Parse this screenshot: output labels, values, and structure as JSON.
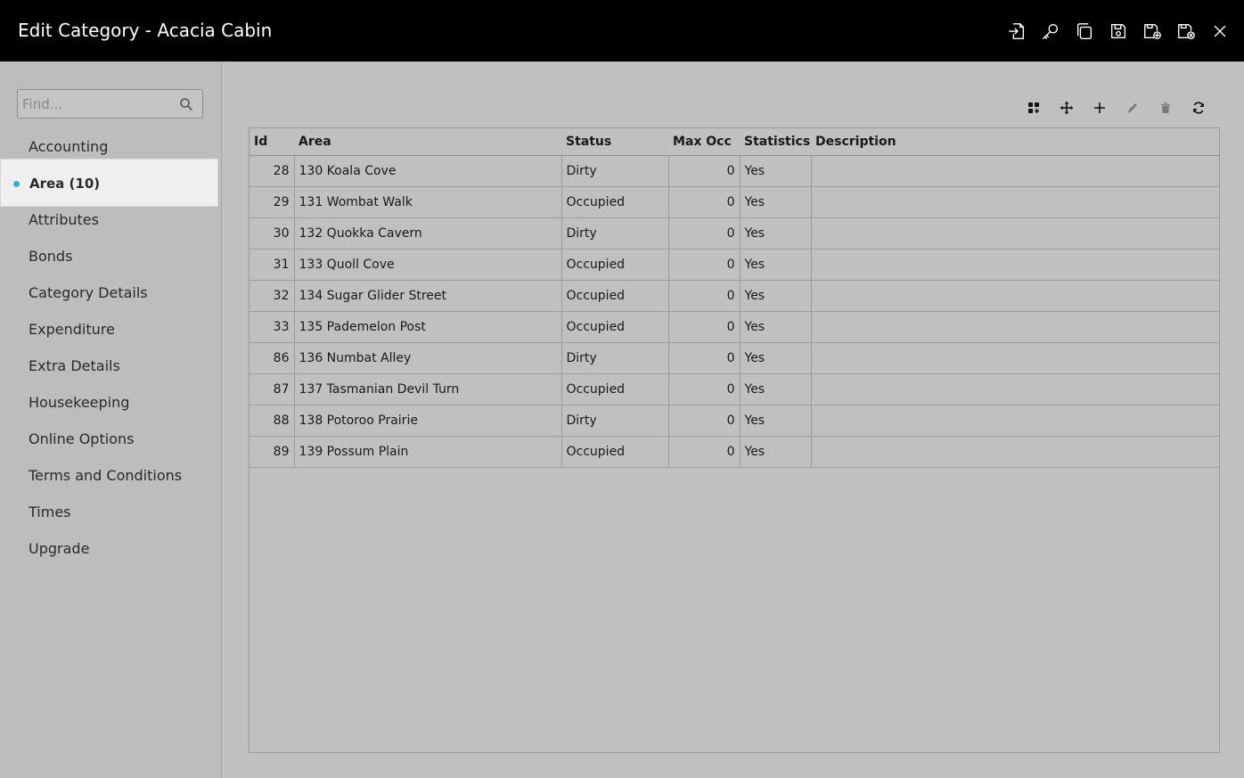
{
  "window": {
    "title": "Edit Category - Acacia Cabin"
  },
  "titlebar_actions": [
    {
      "icon": "export-icon"
    },
    {
      "icon": "key-icon"
    },
    {
      "icon": "copy-icon"
    },
    {
      "icon": "save-icon"
    },
    {
      "icon": "save-add-icon"
    },
    {
      "icon": "save-close-icon"
    },
    {
      "icon": "close-icon"
    }
  ],
  "sidebar": {
    "search_placeholder": "Find...",
    "items": [
      {
        "label": "Accounting"
      },
      {
        "label": "Area (10)",
        "active": true
      },
      {
        "label": "Attributes"
      },
      {
        "label": "Bonds"
      },
      {
        "label": "Category Details"
      },
      {
        "label": "Expenditure"
      },
      {
        "label": "Extra Details"
      },
      {
        "label": "Housekeeping"
      },
      {
        "label": "Online Options"
      },
      {
        "label": "Terms and Conditions"
      },
      {
        "label": "Times"
      },
      {
        "label": "Upgrade"
      }
    ]
  },
  "toolbar": [
    {
      "icon": "grid-add-icon"
    },
    {
      "icon": "move-icon"
    },
    {
      "icon": "plus-icon"
    },
    {
      "icon": "edit-icon"
    },
    {
      "icon": "delete-icon"
    },
    {
      "icon": "refresh-icon"
    }
  ],
  "table": {
    "columns": [
      "Id",
      "Area",
      "Status",
      "Max Occ",
      "Statistics",
      "Description"
    ],
    "rows": [
      {
        "id": "28",
        "area": "130 Koala Cove",
        "status": "Dirty",
        "max_occ": "0",
        "statistics": "Yes",
        "description": ""
      },
      {
        "id": "29",
        "area": "131 Wombat Walk",
        "status": "Occupied",
        "max_occ": "0",
        "statistics": "Yes",
        "description": ""
      },
      {
        "id": "30",
        "area": "132 Quokka Cavern",
        "status": "Dirty",
        "max_occ": "0",
        "statistics": "Yes",
        "description": ""
      },
      {
        "id": "31",
        "area": "133 Quoll Cove",
        "status": "Occupied",
        "max_occ": "0",
        "statistics": "Yes",
        "description": ""
      },
      {
        "id": "32",
        "area": "134 Sugar Glider Street",
        "status": "Occupied",
        "max_occ": "0",
        "statistics": "Yes",
        "description": ""
      },
      {
        "id": "33",
        "area": "135 Pademelon Post",
        "status": "Occupied",
        "max_occ": "0",
        "statistics": "Yes",
        "description": ""
      },
      {
        "id": "86",
        "area": "136 Numbat Alley",
        "status": "Dirty",
        "max_occ": "0",
        "statistics": "Yes",
        "description": ""
      },
      {
        "id": "87",
        "area": "137 Tasmanian Devil Turn",
        "status": "Occupied",
        "max_occ": "0",
        "statistics": "Yes",
        "description": ""
      },
      {
        "id": "88",
        "area": "138 Potoroo Prairie",
        "status": "Dirty",
        "max_occ": "0",
        "statistics": "Yes",
        "description": ""
      },
      {
        "id": "89",
        "area": "139 Possum Plain",
        "status": "Occupied",
        "max_occ": "0",
        "statistics": "Yes",
        "description": ""
      }
    ]
  }
}
